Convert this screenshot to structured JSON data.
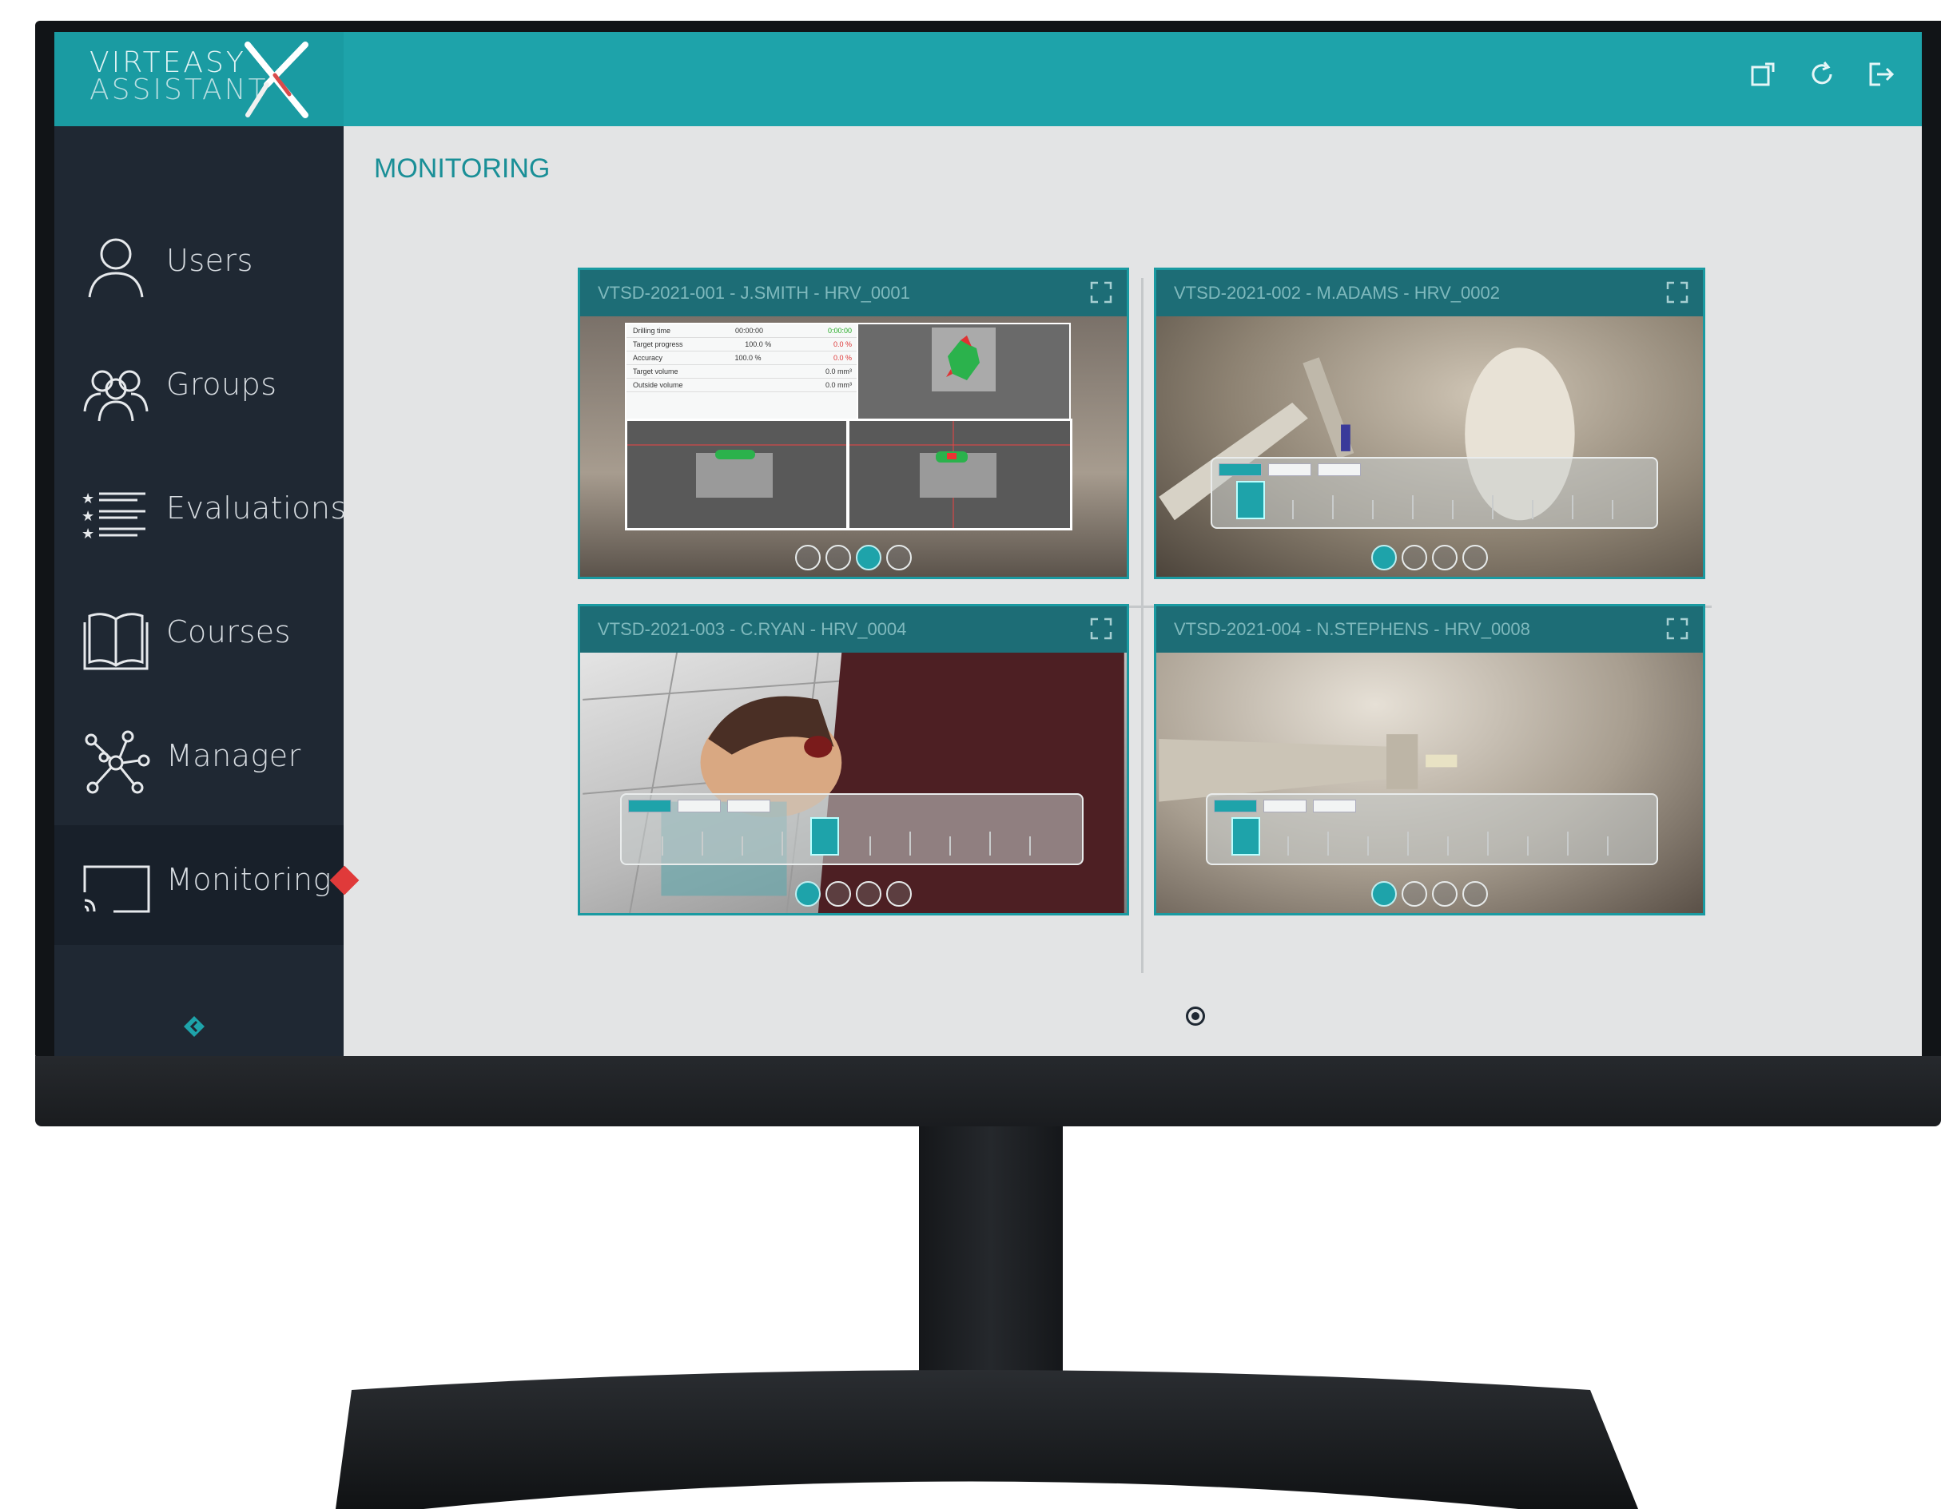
{
  "app": {
    "logo_line1": "VIRTEASY",
    "logo_line2": "ASSISTANT",
    "brand_color": "#1ea3aa",
    "sidebar_color": "#1f2833",
    "active_marker_color": "#e03a3a"
  },
  "header": {
    "icons": [
      "window-icon",
      "refresh-icon",
      "logout-icon"
    ]
  },
  "sidebar": {
    "items": [
      {
        "label": "Users",
        "icon": "user-icon"
      },
      {
        "label": "Groups",
        "icon": "group-icon"
      },
      {
        "label": "Evaluations",
        "icon": "star-list-icon"
      },
      {
        "label": "Courses",
        "icon": "book-icon"
      },
      {
        "label": "Manager",
        "icon": "network-icon"
      },
      {
        "label": "Monitoring",
        "icon": "cast-screen-icon",
        "active": true
      }
    ],
    "collapse_icon": "chevron-left-icon"
  },
  "main": {
    "title": "MONITORING",
    "panels": [
      {
        "title": "VTSD-2021-001 - J.SMITH - HRV_0001",
        "tools_active": 2
      },
      {
        "title": "VTSD-2021-002 - M.ADAMS - HRV_0002",
        "tools_active": 0
      },
      {
        "title": "VTSD-2021-003 - C.RYAN - HRV_0004",
        "tools_active": 0
      },
      {
        "title": "VTSD-2021-004 - N.STEPHENS - HRV_0008",
        "tools_active": 0
      }
    ],
    "stats": {
      "rows": [
        {
          "label": "Drilling time",
          "value": "00:00:00",
          "delta": "0:00:00"
        },
        {
          "label": "Target progress",
          "value": "100.0 %",
          "delta": "0.0 %"
        },
        {
          "label": "Accuracy",
          "value": "100.0 %",
          "delta": "0.0 %"
        },
        {
          "label": "Target volume",
          "value": "",
          "delta": "0.0 mm³"
        },
        {
          "label": "Outside volume",
          "value": "",
          "delta": "0.0 mm³"
        }
      ]
    },
    "pager": {
      "current": 1,
      "total": 1
    }
  }
}
